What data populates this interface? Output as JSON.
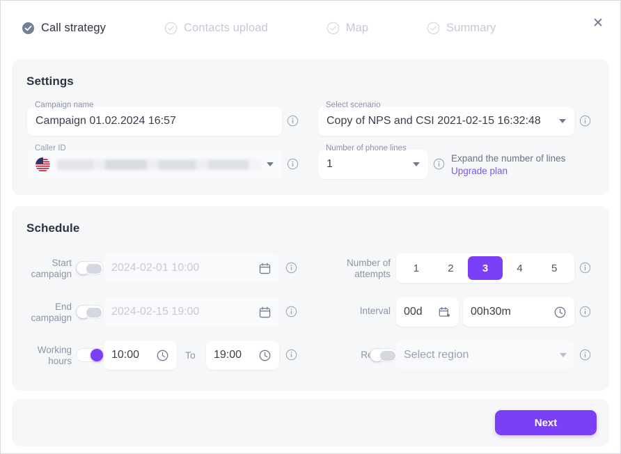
{
  "dialog": {
    "close_label": "✕"
  },
  "stepper": {
    "steps": [
      {
        "label": "Call strategy",
        "state": "active"
      },
      {
        "label": "Contacts upload",
        "state": "inactive"
      },
      {
        "label": "Map",
        "state": "inactive"
      },
      {
        "label": "Summary",
        "state": "inactive"
      }
    ]
  },
  "settings": {
    "title": "Settings",
    "campaign_name": {
      "label": "Campaign name",
      "value": "Campaign 01.02.2024 16:57"
    },
    "caller_id": {
      "label": "Caller ID",
      "value": "",
      "flag": "us-flag-icon",
      "redacted": true
    },
    "scenario": {
      "label": "Select scenario",
      "value": "Copy of NPS and CSI 2021-02-15 16:32:48"
    },
    "phone_lines": {
      "label": "Number of phone lines",
      "value": "1"
    },
    "expand_note": "Expand the number of lines",
    "upgrade_link": "Upgrade plan"
  },
  "schedule": {
    "title": "Schedule",
    "start_campaign": {
      "label": "Start\ncampaign",
      "value": "2024-02-01 10:00",
      "toggle_on": false
    },
    "end_campaign": {
      "label": "End\ncampaign",
      "value": "2024-02-15 19:00",
      "toggle_on": false
    },
    "working_hours": {
      "label": "Working\nhours",
      "from": "10:00",
      "to": "19:00",
      "separator": "To",
      "toggle_on": true
    },
    "attempts": {
      "label": "Number of\nattempts",
      "options": [
        "1",
        "2",
        "3",
        "4",
        "5"
      ],
      "selected": "3"
    },
    "interval": {
      "label": "Interval",
      "days": "00d",
      "time": "00h30m"
    },
    "region": {
      "label": "Region",
      "placeholder": "Select region",
      "toggle_on": false
    }
  },
  "footer": {
    "next_label": "Next"
  },
  "colors": {
    "accent": "#7b3ff5",
    "link": "#7f52f2",
    "panel_bg": "#f6f7f9",
    "text": "#2e3142",
    "muted": "#8d93a8",
    "step_active": "#708097",
    "step_inactive": "#d5d8e0"
  }
}
